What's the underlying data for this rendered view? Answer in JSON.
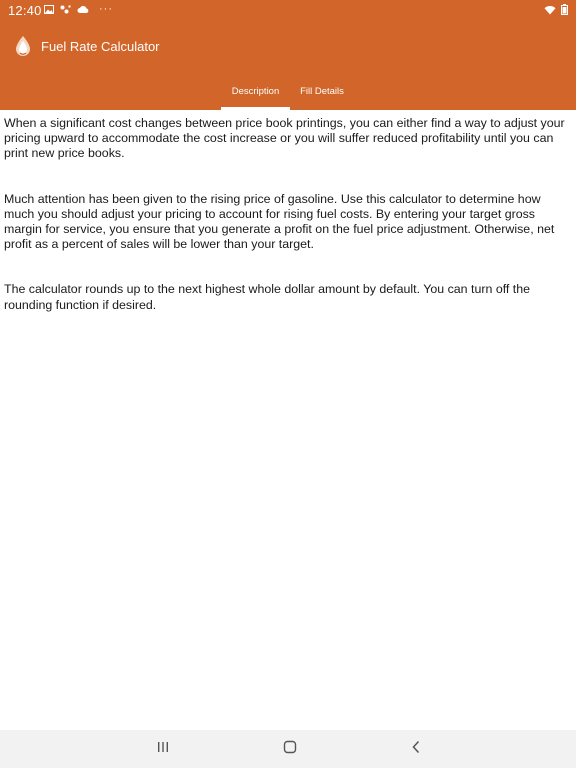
{
  "status_bar": {
    "time": "12:40",
    "dots": "···"
  },
  "app": {
    "title": "Fuel Rate Calculator"
  },
  "tabs": [
    {
      "label": "Description",
      "active": true
    },
    {
      "label": "Fill Details",
      "active": false
    }
  ],
  "description": {
    "paragraphs": [
      "When a significant cost changes between price book printings, you can either find a way to adjust your pricing upward to accommodate the cost increase or you will suffer reduced profitability until you can print new price books.",
      "Much attention has been given to the rising price of gasoline.  Use this calculator to determine how much you should adjust your pricing to account for rising fuel costs.  By entering your target gross margin for service, you ensure that you generate a profit on the fuel price adjustment.  Otherwise, net profit as a percent of sales will be lower than your target.",
      "The calculator rounds up to the next highest whole dollar amount by default.  You can turn off the rounding function if desired."
    ]
  },
  "colors": {
    "header": "#d1652a",
    "text": "#1a1a1a",
    "navbar": "#f2f2f2"
  },
  "icons": {
    "status_left": [
      "image-icon",
      "network-icon",
      "cloud-icon"
    ],
    "status_right": [
      "wifi-icon",
      "battery-icon"
    ],
    "app": "fuel-drop-logo-icon",
    "nav": [
      "recents-icon",
      "home-icon",
      "back-icon"
    ]
  }
}
